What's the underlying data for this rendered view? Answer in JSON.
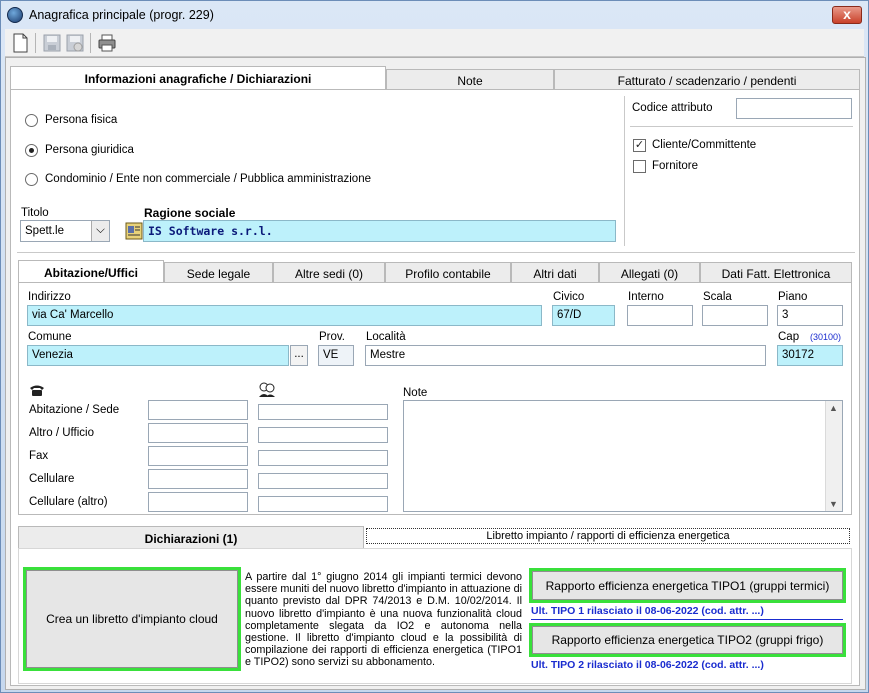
{
  "window": {
    "title": "Anagrafica principale",
    "subtitle": "(progr. 229)",
    "close_label": "x"
  },
  "toolbar": {
    "icons": [
      "new-document-icon",
      "save-icon",
      "save-disabled-icon",
      "print-icon"
    ]
  },
  "main_tabs": [
    {
      "label": "Informazioni anagrafiche / Dichiarazioni",
      "active": true
    },
    {
      "label": "Note",
      "active": false
    },
    {
      "label": "Fatturato / scadenzario / pendenti",
      "active": false
    }
  ],
  "person_type": {
    "options": [
      {
        "label": "Persona fisica",
        "selected": false
      },
      {
        "label": "Persona giuridica",
        "selected": true
      },
      {
        "label": "Condominio / Ente non commerciale / Pubblica amministrazione",
        "selected": false
      }
    ]
  },
  "attributes": {
    "codice_label": "Codice attributo",
    "codice_value": "",
    "cliente_label": "Cliente/Committente",
    "cliente_checked": true,
    "fornitore_label": "Fornitore",
    "fornitore_checked": false
  },
  "titolo": {
    "label": "Titolo",
    "value": "Spett.le"
  },
  "ragione_sociale": {
    "label": "Ragione sociale",
    "value": "IS Software s.r.l."
  },
  "address_tabs": [
    {
      "label": "Abitazione/Uffici",
      "active": true
    },
    {
      "label": "Sede legale",
      "active": false
    },
    {
      "label": "Altre sedi (0)",
      "active": false
    },
    {
      "label": "Profilo contabile",
      "active": false
    },
    {
      "label": "Altri dati",
      "active": false
    },
    {
      "label": "Allegati (0)",
      "active": false
    },
    {
      "label": "Dati Fatt. Elettronica",
      "active": false
    }
  ],
  "address": {
    "indirizzo_label": "Indirizzo",
    "indirizzo": "via Ca' Marcello",
    "civico_label": "Civico",
    "civico": "67/D",
    "interno_label": "Interno",
    "interno": "",
    "scala_label": "Scala",
    "scala": "",
    "piano_label": "Piano",
    "piano": "3",
    "comune_label": "Comune",
    "comune": "Venezia",
    "comune_btn": "...",
    "prov_label": "Prov.",
    "prov": "VE",
    "localita_label": "Località",
    "localita": "Mestre",
    "cap_label": "Cap",
    "cap_hint": "(30100)",
    "cap": "30172"
  },
  "contacts": {
    "rows": [
      "Abitazione / Sede",
      "Altro / Ufficio",
      "Fax",
      "Cellulare",
      "Cellulare (altro)"
    ],
    "note_label": "Note"
  },
  "bottom_tabs": [
    {
      "label": "Dichiarazioni (1)",
      "active": true
    },
    {
      "label": "Libretto impianto / rapporti di efficienza energetica",
      "active": false
    }
  ],
  "declarations": {
    "cloud_button": "Crea un libretto d'impianto cloud",
    "paragraph": "A partire dal 1° giugno 2014 gli impianti termici devono essere muniti del nuovo libretto d'impianto in attuazione di quanto previsto dal DPR 74/2013 e D.M. 10/02/2014. Il nuovo libretto d'impianto è una nuova funzionalità cloud completamente slegata da IO2 e autonoma nella gestione. Il libretto d'impianto cloud e la possibilità di compilazione dei rapporti di efficienza energetica (TIPO1 e TIPO2) sono servizi su abbonamento.",
    "tipo1_button": "Rapporto efficienza energetica TIPO1 (gruppi termici)",
    "tipo1_note": "Ult. TIPO 1 rilasciato il 08-06-2022 (cod. attr. ...)",
    "tipo2_button": "Rapporto efficienza energetica TIPO2 (gruppi frigo)",
    "tipo2_note": "Ult. TIPO 2 rilasciato il 08-06-2022 (cod. attr. ...)"
  }
}
